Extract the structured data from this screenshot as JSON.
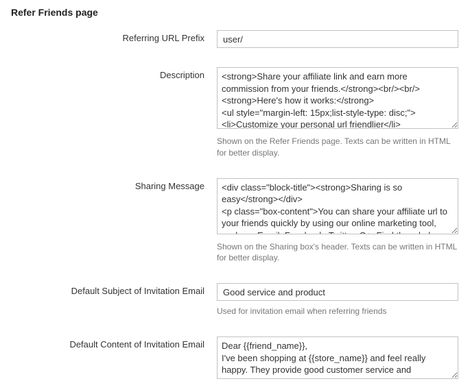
{
  "section_title": "Refer Friends page",
  "fields": {
    "url_prefix": {
      "label": "Referring URL Prefix",
      "value": "user/"
    },
    "description": {
      "label": "Description",
      "value": "<strong>Share your affiliate link and earn more commission from your friends.</strong><br/><br/>\n<strong>Here's how it works:</strong>\n<ul style=\"margin-left: 15px;list-style-type: disc;\">\n<li>Customize your personal url friendlier</li>\n<li>Share your customized link with your friends</li>",
      "hint": "Shown on the Refer Friends page. Texts can be written in HTML for better display."
    },
    "sharing_message": {
      "label": "Sharing Message",
      "value": "<div class=\"block-title\"><strong>Sharing is so easy</strong></div>\n<p class=\"box-content\">You can share your affiliate url to your friends quickly by using our online marketing tool, such as: Email, Facebook, Twitter, G+. Find them below:</p>",
      "hint": "Shown on the Sharing box's header. Texts can be written in HTML for better display."
    },
    "invite_subject": {
      "label": "Default Subject of Invitation Email",
      "value": "Good service and product",
      "hint": "Used for invitation email when referring friends"
    },
    "invite_content": {
      "label": "Default Content of Invitation Email",
      "value": "Dear {{friend_name}},\nI've been shopping at {{store_name}} and feel really happy. They provide good customer service and reasonable prices."
    }
  }
}
